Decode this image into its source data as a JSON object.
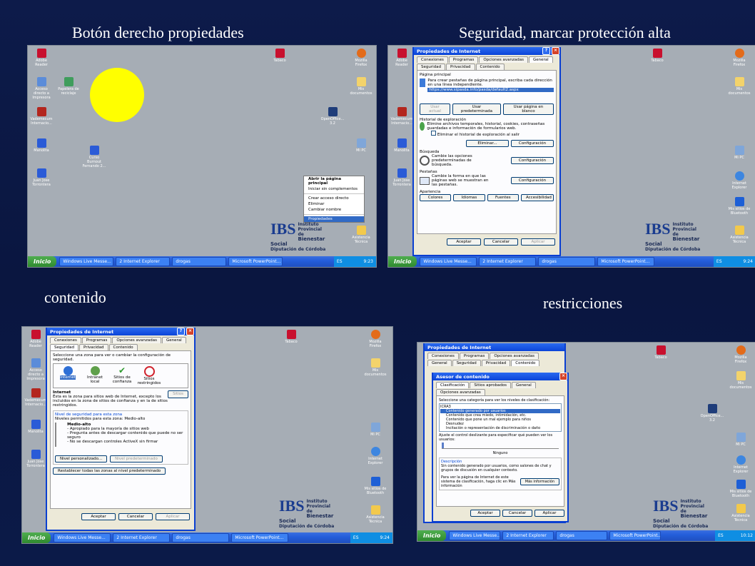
{
  "captions": {
    "top_left": "Botón derecho propiedades",
    "top_right": "Seguridad, marcar  protección alta",
    "bottom_left": "contenido",
    "bottom_right": "restricciones"
  },
  "desktop_icons": {
    "adobe": "Adobe Reader",
    "acceso": "Acceso directo a Impresora",
    "vademecum": "Vademecum Internacio...",
    "manolita": "Manolita",
    "juan": "Juan Jose Torrontera",
    "papelera": "Papelera de reciclaje",
    "curso": "Curso Burnout Fernando 2...",
    "tabaco": "Tabaco",
    "firefox": "Mozilla Firefox",
    "mis_doc": "Mis documentos",
    "mipc": "Mi PC",
    "ie": "Internet Explorer",
    "openoffice": "OpenOffice... 3.2",
    "bluetooth": "Mis sitios de Bluetooth",
    "asistencia": "Asistencia Técnica",
    "escritorio": "Escritorio"
  },
  "taskbar": {
    "start": "Inicio",
    "btn1": "Windows Live Messe...",
    "btn2": "2 Internet Explorer",
    "btn3": "drogas",
    "btn4": "Microsoft PowerPoint...",
    "lang": "ES",
    "time1": "9:23",
    "time2": "9:24",
    "time3": "9:24",
    "time4": "10:12"
  },
  "context_menu": {
    "open": "Abrir la página principal",
    "no_addons": "Iniciar sin complementos",
    "shortcut": "Crear acceso directo",
    "delete": "Eliminar",
    "rename": "Cambiar nombre",
    "properties": "Propiedades"
  },
  "logo": {
    "line1": "Instituto Provincial de",
    "line2": "Bienestar Social",
    "line3": "Diputación de Córdoba"
  },
  "dialog_general": {
    "title": "Propiedades de Internet",
    "tabs": [
      "Conexiones",
      "Programas",
      "Opciones avanzadas",
      "General",
      "Seguridad",
      "Privacidad",
      "Contenido"
    ],
    "home_page": "Página principal",
    "home_desc": "Para crear pestañas de página principal, escriba cada dirección en una línea independiente.",
    "home_url": "https://www.sipasda.info/pasda/default2.aspx",
    "btn_current": "Usar actual",
    "btn_default": "Usar predeterminada",
    "btn_blank": "Usar página en blanco",
    "history": "Historial de exploración",
    "history_desc": "Elimine archivos temporales, historial, cookies, contraseñas guardadas e información de formularios web.",
    "history_check": "Eliminar el historial de exploración al salir",
    "btn_delete": "Eliminar...",
    "btn_config": "Configuración",
    "search": "Búsqueda",
    "search_desc": "Cambie las opciones predeterminadas de búsqueda.",
    "tabs_section": "Pestañas",
    "tabs_desc": "Cambie la forma en que las páginas web se muestran en las pestañas.",
    "appearance": "Apariencia",
    "btn_colors": "Colores",
    "btn_languages": "Idiomas",
    "btn_fonts": "Fuentes",
    "btn_access": "Accesibilidad",
    "btn_ok": "Aceptar",
    "btn_cancel": "Cancelar",
    "btn_apply": "Aplicar"
  },
  "dialog_security": {
    "select_zone": "Seleccione una zona para ver o cambiar la configuración de seguridad.",
    "zones": [
      "Internet",
      "Intranet local",
      "Sitios de confianza",
      "Sitios restringidos"
    ],
    "zone_title": "Internet",
    "zone_desc": "Ésta es la zona para sitios web de Internet, excepto los incluidos en la zona de sitios de confianza y en la de sitios restringidos.",
    "btn_sites": "Sitios",
    "level_group": "Nivel de seguridad para esta zona",
    "allowed": "Niveles permitidos para esta zona: Medio-alto",
    "level": "Medio-alto",
    "bullet1": "- Apropiado para la mayoría de sitios web",
    "bullet2": "- Pregunta antes de descargar contenido que puede no ser seguro",
    "bullet3": "- No se descargan controles ActiveX sin firmar",
    "btn_custom": "Nivel personalizado...",
    "btn_default_level": "Nivel predeterminado",
    "btn_reset": "Restablecer todas las zonas al nivel predeterminado"
  },
  "dialog_content": {
    "title": "Asesor de contenido",
    "tabs": [
      "Clasificación",
      "Sitios aprobados",
      "General",
      "Opciones avanzadas"
    ],
    "select_cat": "Seleccione una categoría para ver los niveles de clasificación:",
    "items": [
      "ICRA3",
      "Contenido generado por usuarios",
      "Contenido que crea miedo, intimidación, etc.",
      "Contenido que pone un mal ejemplo para niños",
      "Desnudez",
      "Incitación o representación de discriminación o daño"
    ],
    "slider_label": "Ajuste el control deslizante para especificar qué pueden ver los usuarios:",
    "level": "Ninguno",
    "desc_group": "Descripción",
    "desc": "Sin contenido generado por usuarios, como salones de chat y grupos de discusión en cualquier contexto.",
    "more_info": "Para ver la página de Internet de este sistema de clasificación, haga clic en Más información",
    "btn_more": "Más información"
  }
}
